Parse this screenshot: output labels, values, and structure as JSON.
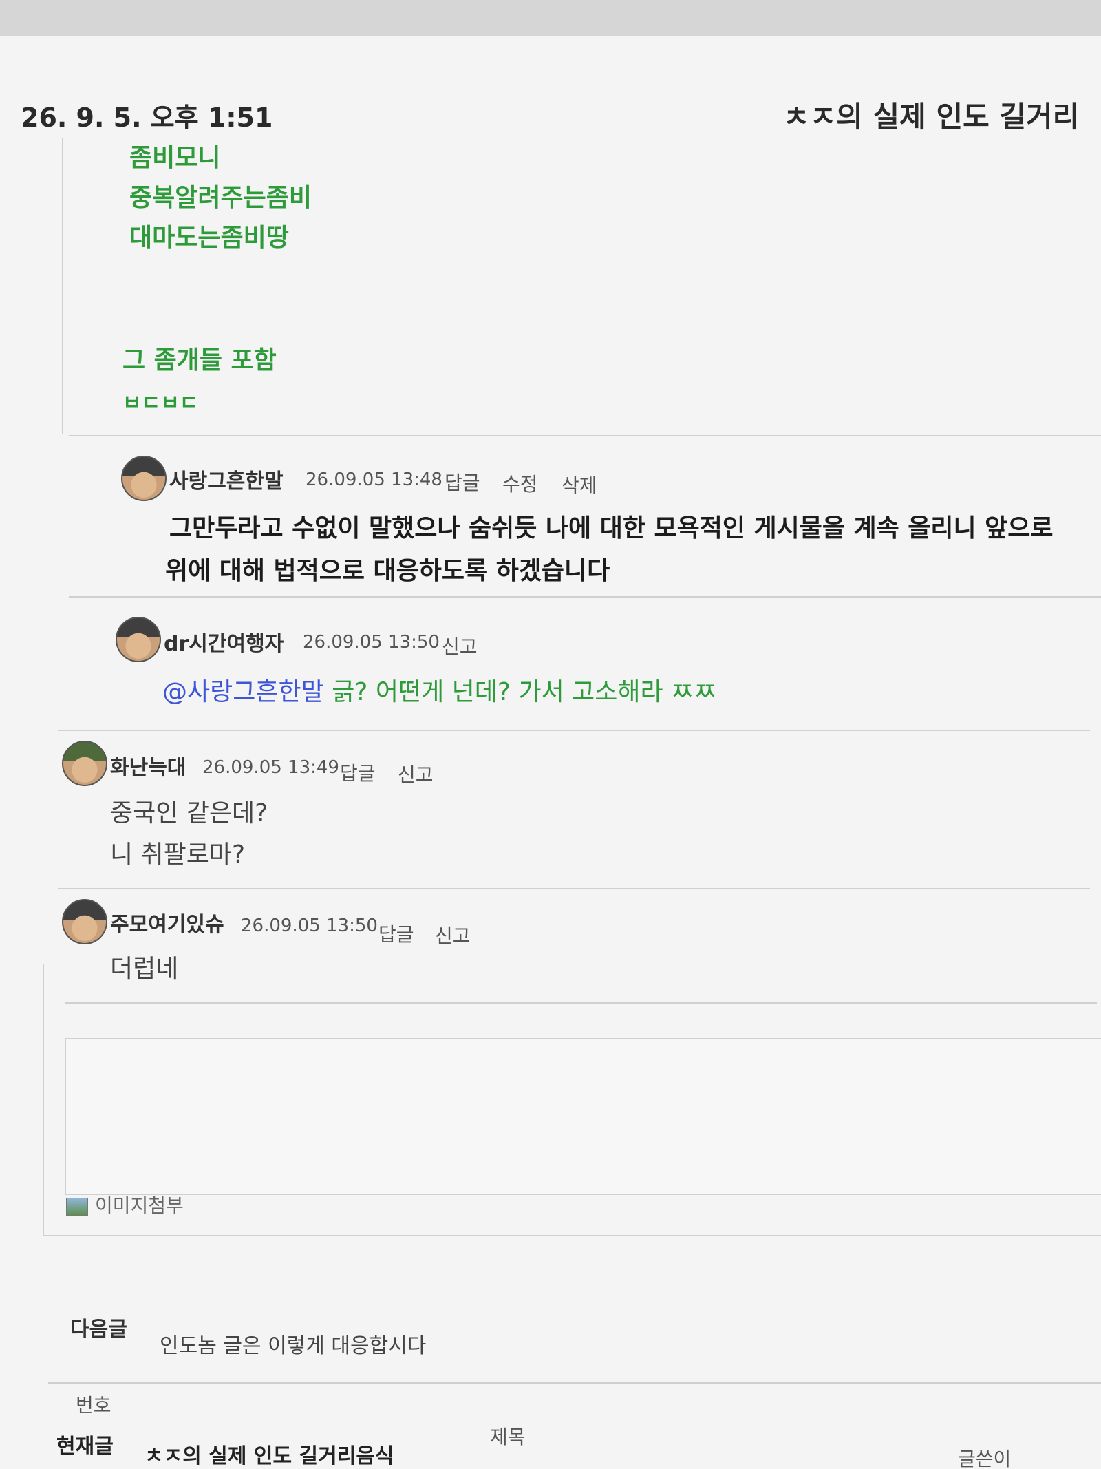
{
  "header": {
    "printed_datetime": "26. 9. 5. 오후 1:51",
    "page_title": "ㅊㅈ의 실제 인도 길거리"
  },
  "post": {
    "lines": [
      "좀비모니",
      "중복알려주는좀비",
      "대마도는좀비땅",
      "그 좀개들 포함",
      "ㅂㄷㅂㄷ"
    ]
  },
  "comments": [
    {
      "nickname": "사랑그흔한말",
      "datetime": "26.09.05 13:48",
      "actions": [
        "답글",
        "수정",
        "삭제"
      ],
      "lines": [
        "그만두라고 수없이 말했으나 숨쉬듯 나에 대한 모욕적인 게시물을 계속 올리니 앞으로",
        "위에 대해 법적으로 대응하도록 하겠습니다"
      ]
    },
    {
      "nickname": "dr시간여행자",
      "datetime": "26.09.05 13:50",
      "actions": [
        "신고"
      ],
      "mention": "@사랑그흔한말",
      "lines": [
        "긁? 어떤게 넌데? 가서 고소해라 ㅉㅉ"
      ]
    },
    {
      "nickname": "화난늑대",
      "datetime": "26.09.05 13:49",
      "actions": [
        "답글",
        "신고"
      ],
      "lines": [
        "중국인 같은데?",
        "니 취팔로마?"
      ]
    },
    {
      "nickname": "주모여기있슈",
      "datetime": "26.09.05 13:50",
      "actions": [
        "답글",
        "신고"
      ],
      "lines": [
        "더럽네"
      ]
    }
  ],
  "reply_form": {
    "attach_label": "이미지첨부"
  },
  "navigation": {
    "next_label": "다음글",
    "next_title": "인도놈 글은 이렇게 대응합시다"
  },
  "list_table": {
    "headers": [
      "번호",
      "제목",
      "글쓴이"
    ],
    "current_label": "현재글",
    "current_title": "ㅊㅈ의 실제 인도 길거리음식"
  }
}
